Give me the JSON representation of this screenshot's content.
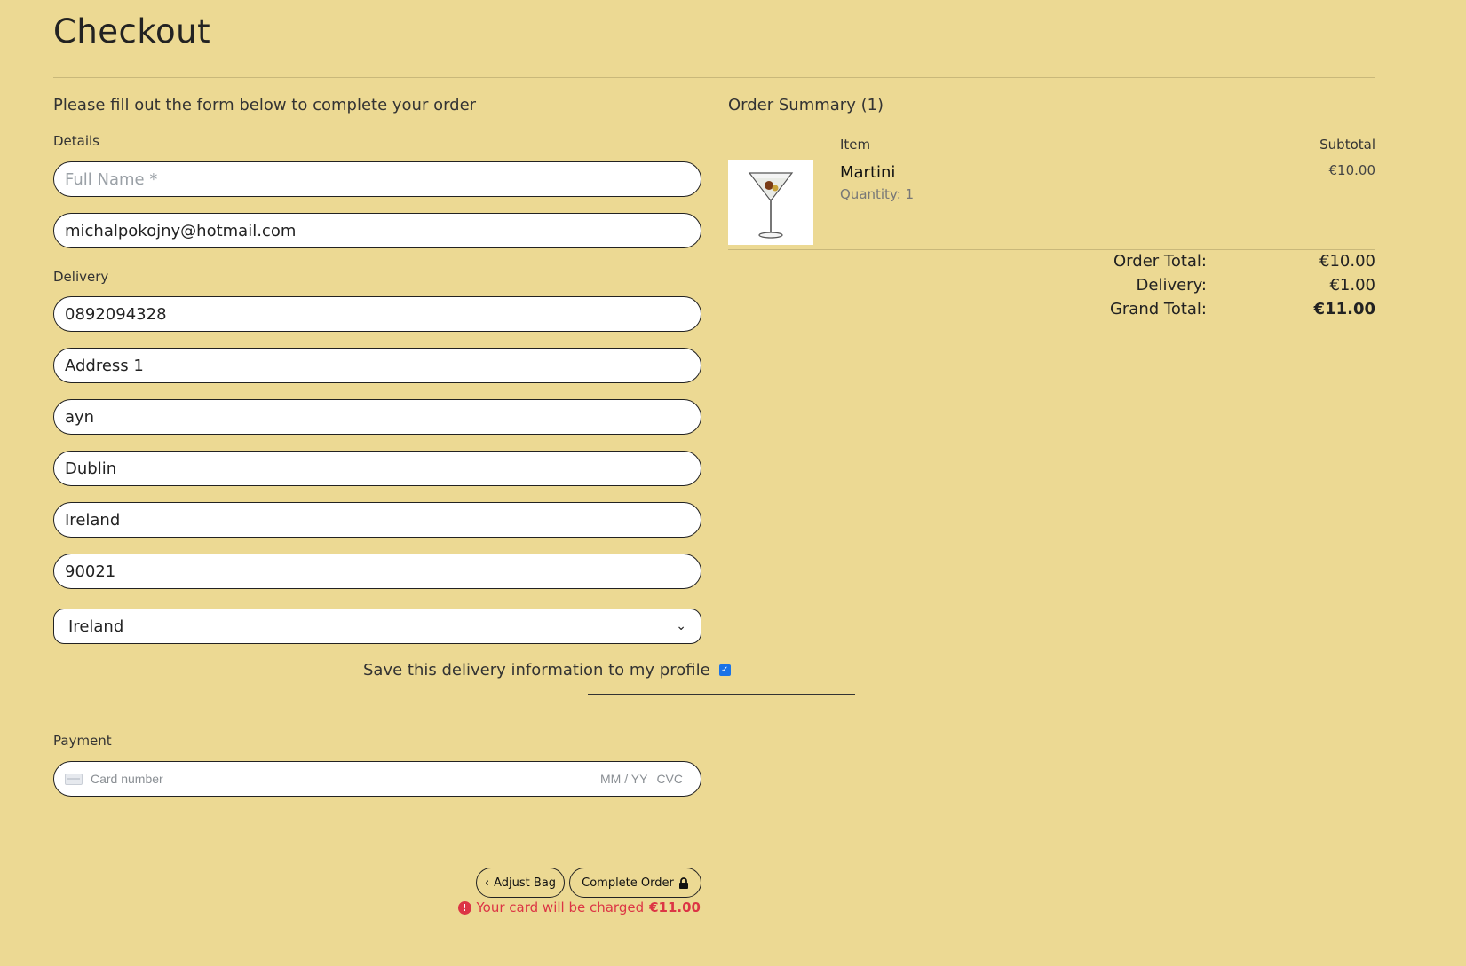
{
  "page": {
    "title": "Checkout",
    "intro": "Please fill out the form below to complete your order"
  },
  "form": {
    "details_label": "Details",
    "full_name": {
      "value": "",
      "placeholder": "Full Name *"
    },
    "email": {
      "value": "michalpokojny@hotmail.com"
    },
    "delivery_label": "Delivery",
    "phone": {
      "value": "0892094328"
    },
    "address1": {
      "value": "Address 1"
    },
    "address2": {
      "value": "ayn"
    },
    "town": {
      "value": "Dublin"
    },
    "county": {
      "value": "Ireland"
    },
    "postcode": {
      "value": "90021"
    },
    "country_selected": "Ireland",
    "save_info_label": "Save this delivery information to my profile",
    "save_info_checked": true,
    "payment_label": "Payment",
    "card": {
      "number_placeholder": "Card number",
      "expiry_placeholder": "MM / YY",
      "cvc_placeholder": "CVC"
    }
  },
  "actions": {
    "adjust_bag": "Adjust Bag",
    "complete_order": "Complete Order",
    "charge_text": "Your card will be charged",
    "charge_amount": "€11.00"
  },
  "summary": {
    "title": "Order Summary (1)",
    "col_item": "Item",
    "col_subtotal": "Subtotal",
    "items": [
      {
        "name": "Martini",
        "quantity": "Quantity: 1",
        "subtotal": "€10.00"
      }
    ],
    "order_total_label": "Order Total:",
    "order_total": "€10.00",
    "delivery_label": "Delivery:",
    "delivery": "€1.00",
    "grand_total_label": "Grand Total:",
    "grand_total": "€11.00"
  },
  "colors": {
    "background": "#ecd993",
    "alert": "#dc3545",
    "checkbox": "#1a73e8"
  }
}
